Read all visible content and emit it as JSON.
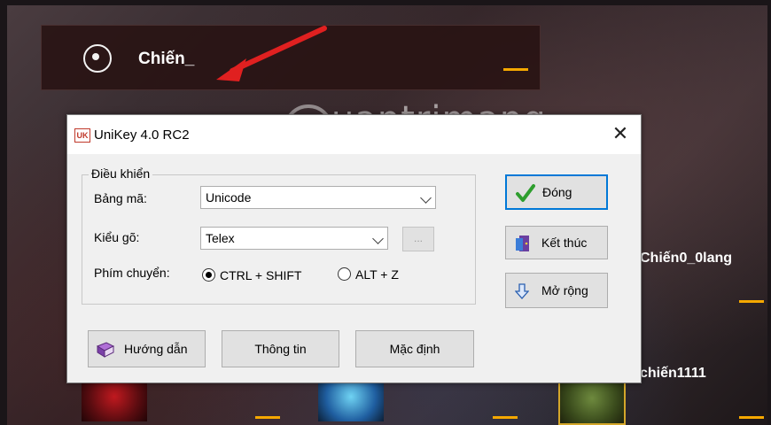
{
  "background": {
    "player_name": "Chiến_",
    "other_players": [
      "Chiến0_0lang",
      "chiến1111"
    ],
    "watermark": "uantrimang"
  },
  "window": {
    "title": "UniKey 4.0 RC2",
    "close_symbol": "✕"
  },
  "controls": {
    "group_title": "Điều khiển",
    "charset_label": "Bảng mã:",
    "charset_value": "Unicode",
    "input_method_label": "Kiểu gõ:",
    "input_method_value": "Telex",
    "more_button": "...",
    "switch_label": "Phím chuyển:",
    "switch_options": [
      {
        "label": "CTRL + SHIFT",
        "checked": true
      },
      {
        "label": "ALT + Z",
        "checked": false
      }
    ]
  },
  "side_buttons": {
    "close": "Đóng",
    "exit": "Kết thúc",
    "expand": "Mở rộng"
  },
  "bottom_buttons": {
    "guide": "Hướng dẫn",
    "info": "Thông tin",
    "default": "Mặc định"
  },
  "colors": {
    "accent_border": "#0078d7",
    "check_green": "#2e9e2e",
    "highlight_dash": "#f5a800",
    "arrow_red": "#e02020"
  }
}
